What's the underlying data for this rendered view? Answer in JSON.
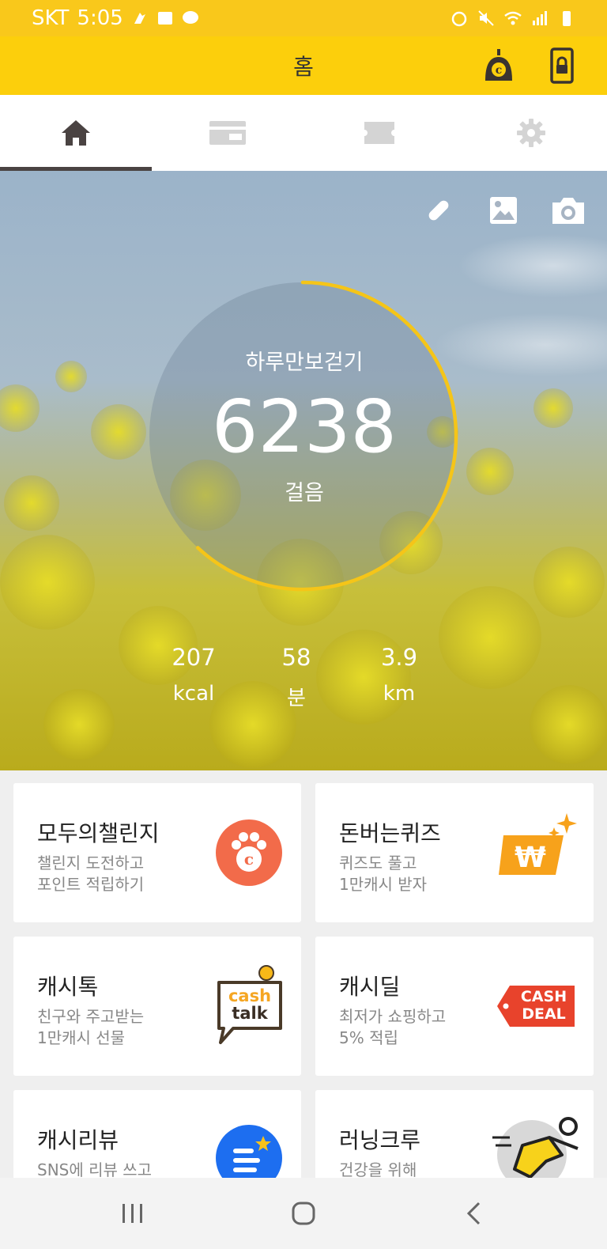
{
  "status_bar": {
    "carrier": "SKT",
    "time": "5:05"
  },
  "app_bar": {
    "title": "홈"
  },
  "hero": {
    "counter_label": "하루만보걷기",
    "step_count": "6238",
    "step_unit": "걸음",
    "progress_fraction": 0.62,
    "stats": [
      {
        "value": "207",
        "unit": "kcal"
      },
      {
        "value": "58",
        "unit": "분"
      },
      {
        "value": "3.9",
        "unit": "km"
      }
    ]
  },
  "cards": [
    {
      "title": "모두의챌린지",
      "desc_line1": "챌린지 도전하고",
      "desc_line2": "포인트 적립하기"
    },
    {
      "title": "돈버는퀴즈",
      "desc_line1": "퀴즈도 풀고",
      "desc_line2": "1만캐시 받자"
    },
    {
      "title": "캐시톡",
      "desc_line1": "친구와 주고받는",
      "desc_line2": "1만캐시 선물"
    },
    {
      "title": "캐시딜",
      "desc_line1": "최저가 쇼핑하고",
      "desc_line2": "5% 적립"
    },
    {
      "title": "캐시리뷰",
      "desc_line1": "SNS에 리뷰 쓰고",
      "desc_line2": ""
    },
    {
      "title": "러닝크루",
      "desc_line1": "건강을 위해",
      "desc_line2": ""
    }
  ],
  "logos": {
    "cashtalk_line1": "cash",
    "cashtalk_line2": "talk",
    "cashdeal_line1": "CASH",
    "cashdeal_line2": "DEAL"
  },
  "colors": {
    "brand_yellow": "#fccf0c",
    "ring_yellow": "#f5c518",
    "challenge_orange": "#f26b4a",
    "quiz_orange": "#f7a21b",
    "deal_red": "#e8432c",
    "review_blue": "#1d6ef0"
  }
}
